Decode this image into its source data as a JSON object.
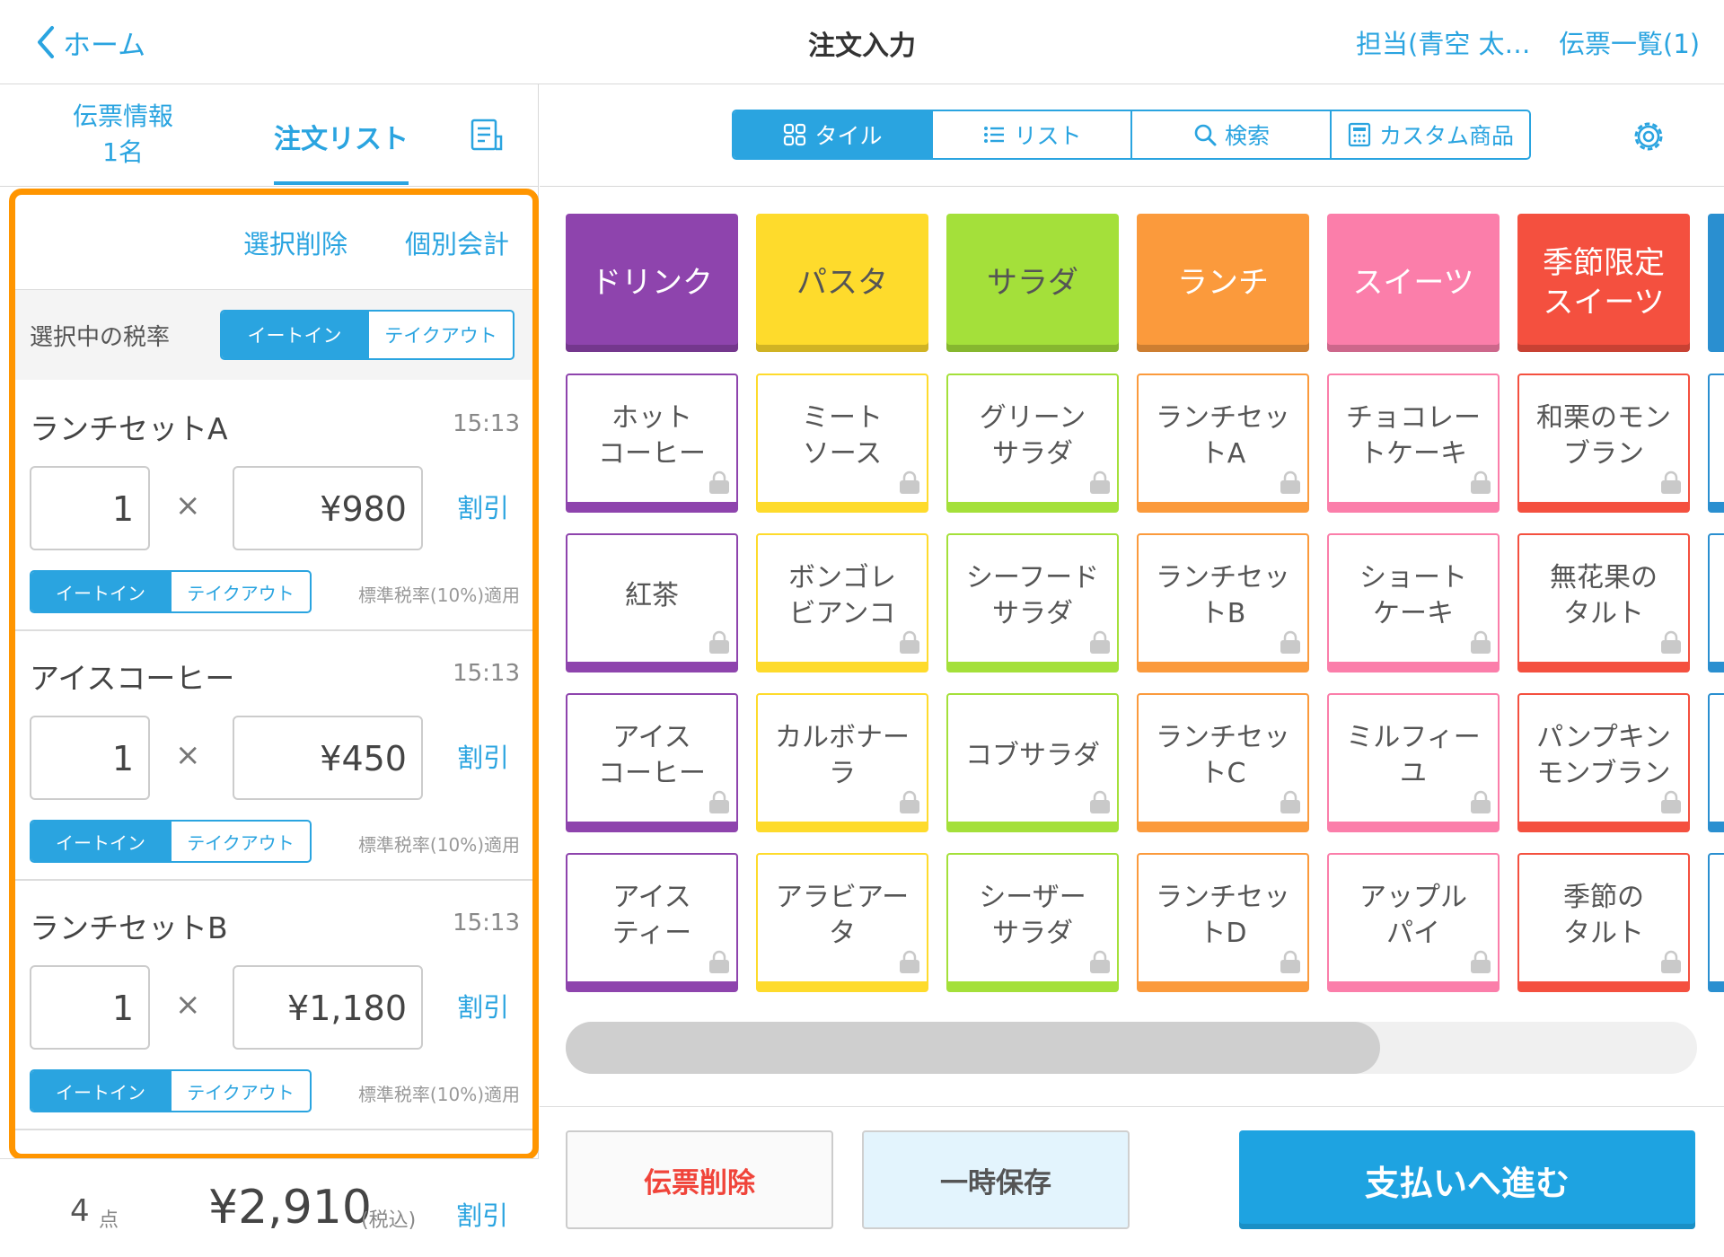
{
  "header": {
    "back_label": "ホーム",
    "title": "注文入力",
    "staff_label": "担当(青空 太…",
    "slip_list_label": "伝票一覧(1)"
  },
  "left": {
    "tab_slip_line1": "伝票情報",
    "tab_slip_line2": "1名",
    "tab_orders": "注文リスト",
    "actions": {
      "delete_selected": "選択削除",
      "split_bill": "個別会計"
    },
    "tax_rate_label": "選択中の税率",
    "tax_options": {
      "eat_in": "イートイン",
      "takeout": "テイクアウト"
    },
    "items": [
      {
        "name": "ランチセットA",
        "time": "15:13",
        "qty": "1",
        "times": "×",
        "price": "¥980",
        "discount": "割引",
        "eat_in": "イートイン",
        "takeout": "テイクアウト",
        "tax_note": "標準税率(10%)適用"
      },
      {
        "name": "アイスコーヒー",
        "time": "15:13",
        "qty": "1",
        "times": "×",
        "price": "¥450",
        "discount": "割引",
        "eat_in": "イートイン",
        "takeout": "テイクアウト",
        "tax_note": "標準税率(10%)適用"
      },
      {
        "name": "ランチセットB",
        "time": "15:13",
        "qty": "1",
        "times": "×",
        "price": "¥1,180",
        "discount": "割引",
        "eat_in": "イートイン",
        "takeout": "テイクアウト",
        "tax_note": "標準税率(10%)適用"
      }
    ],
    "footer": {
      "count": "4",
      "count_unit": "点",
      "total": "¥2,910",
      "tax_incl": "(税込)",
      "discount": "割引"
    }
  },
  "right": {
    "view_tabs": [
      {
        "label": "タイル",
        "icon": "grid-icon",
        "selected": true
      },
      {
        "label": "リスト",
        "icon": "list-icon",
        "selected": false
      },
      {
        "label": "検索",
        "icon": "search-icon",
        "selected": false
      },
      {
        "label": "カスタム商品",
        "icon": "calculator-icon",
        "selected": false
      }
    ],
    "categories": [
      {
        "label": "ドリンク",
        "color": "#8e44ad",
        "text_color": "#ffffff"
      },
      {
        "label": "パスタ",
        "color": "#fedb2c",
        "text_color": "#555555"
      },
      {
        "label": "サラダ",
        "color": "#a4e03a",
        "text_color": "#555555"
      },
      {
        "label": "ランチ",
        "color": "#fb9a3c",
        "text_color": "#ffffff"
      },
      {
        "label": "スイーツ",
        "color": "#fb7eaa",
        "text_color": "#ffffff"
      },
      {
        "label": "季節限定\nスイーツ",
        "color": "#f4503f",
        "text_color": "#ffffff"
      }
    ],
    "products": [
      [
        "ホット\nコーヒー",
        "ミート\nソース",
        "グリーン\nサラダ",
        "ランチセッ\nトA",
        "チョコレー\nトケーキ",
        "和栗のモン\nブラン"
      ],
      [
        "紅茶",
        "ボンゴレ\nビアンコ",
        "シーフード\nサラダ",
        "ランチセッ\nトB",
        "ショート\nケーキ",
        "無花果の\nタルト"
      ],
      [
        "アイス\nコーヒー",
        "カルボナー\nラ",
        "コブサラダ",
        "ランチセッ\nトC",
        "ミルフィー\nユ",
        "パンプキン\nモンブラン"
      ],
      [
        "アイス\nティー",
        "アラビアー\nタ",
        "シーザー\nサラダ",
        "ランチセッ\nトD",
        "アップル\nパイ",
        "季節の\nタルト"
      ]
    ],
    "product_border_colors": [
      "#8e44ad",
      "#fedb2c",
      "#a4e03a",
      "#fb9a3c",
      "#fb7eaa",
      "#f4503f"
    ],
    "edge_column_color": "#2a8fd0",
    "scroll_fraction": 0.72,
    "buttons": {
      "delete_slip": "伝票削除",
      "hold": "一時保存",
      "pay": "支払いへ進む"
    }
  }
}
